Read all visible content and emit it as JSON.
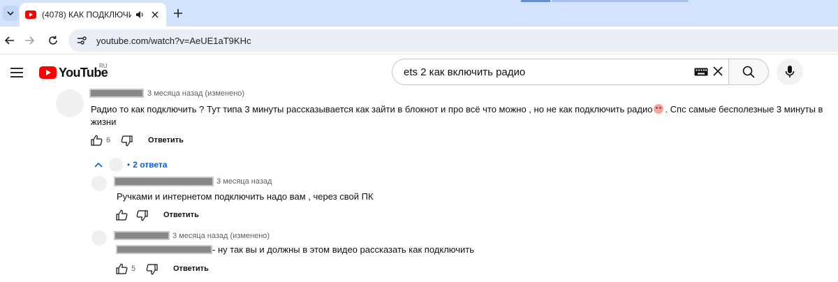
{
  "browser": {
    "tab_title": "(4078) КАК ПОДКЛЮЧИТЬ",
    "url": "youtube.com/watch?v=AeUE1aT9KHc",
    "icons": [
      "tab-list-icon",
      "speaker-icon",
      "close-icon",
      "plus-icon",
      "back-arrow-icon",
      "forward-arrow-icon",
      "site-info-icon"
    ]
  },
  "youtube": {
    "logo_text": "YouTube",
    "region": "RU",
    "search_value": "ets 2 как включить радио"
  },
  "comments": [
    {
      "time": "3 месяца назад (изменено)",
      "text_before_emoji": "Радио то как подключить ? Тут типа 3 минуты рассказывается как зайти в блокнот  и про всё что можно , но не как подключить радио",
      "text_after_emoji": ". Спс самые бесполезные 3 минуты в жизни",
      "likes": "6",
      "reply_label": "Ответить",
      "replies_toggle": "2 ответа",
      "replies_dot": "•"
    }
  ],
  "replies": [
    {
      "time": "3 месяца назад",
      "text": "Ручками и интернетом подключить надо вам , через свой ПК",
      "likes": "",
      "reply_label": "Ответить"
    },
    {
      "time": "3 месяца назад (изменено)",
      "text": "- ну так вы и должны в этом видео рассказать как подключить",
      "likes": "5",
      "reply_label": "Ответить"
    }
  ],
  "colors": {
    "tabstrip": "#d3e3fd",
    "omnibox": "#e9eef6",
    "youtube_red": "#ff0000",
    "link_blue": "#065fd4",
    "redaction": "#888888"
  }
}
